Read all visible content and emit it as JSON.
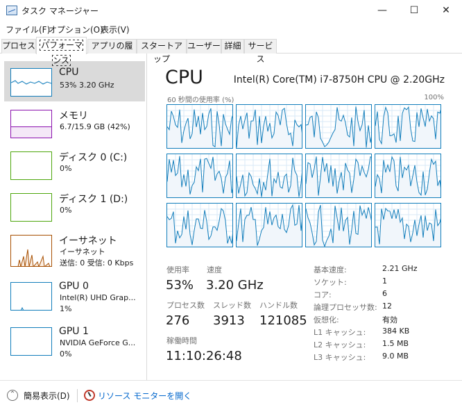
{
  "window": {
    "title": "タスク マネージャー",
    "minimize_glyph": "—",
    "maximize_glyph": "☐",
    "close_glyph": "✕"
  },
  "menu": [
    "ファイル(F)",
    "オプション(O)",
    "表示(V)"
  ],
  "tabs": [
    "プロセス",
    "パフォーマンス",
    "アプリの履歴",
    "スタートアップ",
    "ユーザー",
    "詳細",
    "サービス"
  ],
  "active_tab": "パフォーマンス",
  "sidebar": [
    {
      "id": "cpu",
      "title": "CPU",
      "lines": [
        "53%  3.20 GHz"
      ],
      "thumb_color": "#117dbb",
      "selected": true
    },
    {
      "id": "memory",
      "title": "メモリ",
      "lines": [
        "6.7/15.9 GB (42%)"
      ],
      "thumb_color": "#8b12ae",
      "memory_fill_fraction": 0.42
    },
    {
      "id": "disk0",
      "title": "ディスク 0 (C:)",
      "lines": [
        "0%"
      ],
      "thumb_color": "#4da60c"
    },
    {
      "id": "disk1",
      "title": "ディスク 1 (D:)",
      "lines": [
        "0%"
      ],
      "thumb_color": "#4da60c"
    },
    {
      "id": "ethernet",
      "title": "イーサネット",
      "lines": [
        "イーサネット",
        "送信: 0  受信: 0 Kbps"
      ],
      "thumb_color": "#a74f01"
    },
    {
      "id": "gpu0",
      "title": "GPU 0",
      "lines": [
        "Intel(R) UHD Grap...",
        "1%"
      ],
      "thumb_color": "#117dbb"
    },
    {
      "id": "gpu1",
      "title": "GPU 1",
      "lines": [
        "NVIDIA GeForce G...",
        "0%"
      ],
      "thumb_color": "#117dbb"
    }
  ],
  "cpu": {
    "heading": "CPU",
    "model": "Intel(R) Core(TM) i7-8750H CPU @ 2.20GHz",
    "graph_label": "60 秒間の使用率 (%)",
    "graph_max": "100%",
    "core_count": 12,
    "graph_color": "#117dbb",
    "stats": {
      "utilization_label": "使用率",
      "utilization_value": "53%",
      "speed_label": "速度",
      "speed_value": "3.20 GHz",
      "processes_label": "プロセス数",
      "processes_value": "276",
      "threads_label": "スレッド数",
      "threads_value": "3913",
      "handles_label": "ハンドル数",
      "handles_value": "121085",
      "uptime_label": "稼働時間",
      "uptime_value": "11:10:26:48"
    },
    "specs": [
      {
        "label": "基本速度:",
        "value": "2.21 GHz"
      },
      {
        "label": "ソケット:",
        "value": "1"
      },
      {
        "label": "コア:",
        "value": "6"
      },
      {
        "label": "論理プロセッサ数:",
        "value": "12"
      },
      {
        "label": "仮想化:",
        "value": "有効"
      },
      {
        "label": "L1 キャッシュ:",
        "value": "384 KB"
      },
      {
        "label": "L2 キャッシュ:",
        "value": "1.5 MB"
      },
      {
        "label": "L3 キャッシュ:",
        "value": "9.0 MB"
      }
    ]
  },
  "footer": {
    "fewer_details": "簡易表示(D)",
    "open_resource_monitor": "リソース モニターを開く"
  }
}
